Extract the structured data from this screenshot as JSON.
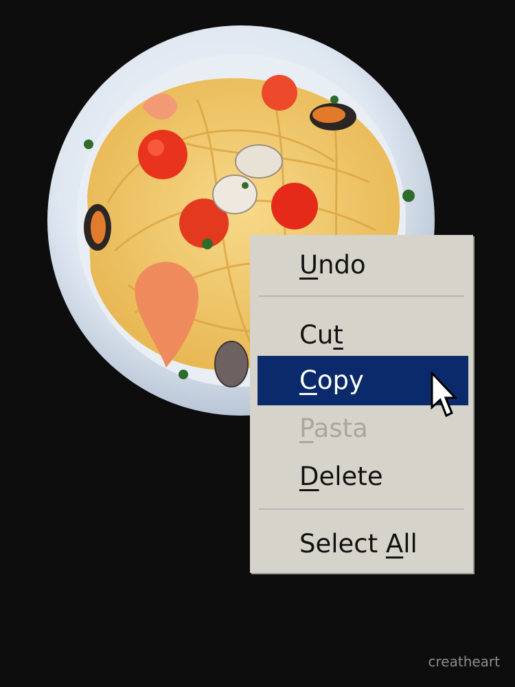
{
  "context_menu": {
    "items": [
      {
        "pre": "",
        "key": "U",
        "post": "ndo",
        "state": "normal"
      },
      {
        "pre": "Cu",
        "key": "t",
        "post": "",
        "state": "normal"
      },
      {
        "pre": "",
        "key": "C",
        "post": "opy",
        "state": "highlighted"
      },
      {
        "pre": "",
        "key": "P",
        "post": "asta",
        "state": "disabled"
      },
      {
        "pre": "",
        "key": "D",
        "post": "elete",
        "state": "normal"
      },
      {
        "pre": "Select ",
        "key": "A",
        "post": "ll",
        "state": "normal"
      }
    ],
    "highlight_color": "#0b2a6b",
    "background_color": "#d6d3ca",
    "disabled_text_color": "#a9a69e"
  },
  "illustration": {
    "subject": "plate-of-seafood-spaghetti-icon"
  },
  "watermark": {
    "text": "creatheart"
  }
}
